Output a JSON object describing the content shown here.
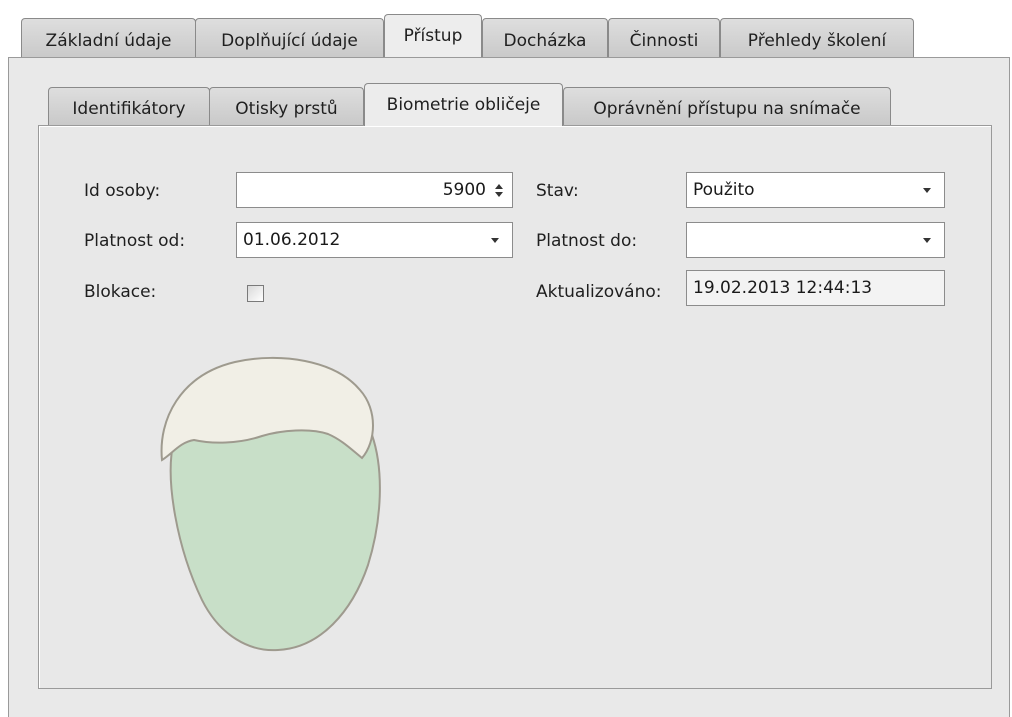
{
  "outer_tabs": [
    {
      "label": "Základní údaje"
    },
    {
      "label": "Doplňující údaje"
    },
    {
      "label": "Přístup"
    },
    {
      "label": "Docházka"
    },
    {
      "label": "Činnosti"
    },
    {
      "label": "Přehledy školení"
    }
  ],
  "outer_active": "Přístup",
  "inner_tabs": [
    {
      "label": "Identifikátory"
    },
    {
      "label": "Otisky prstů"
    },
    {
      "label": "Biometrie obličeje"
    },
    {
      "label": "Oprávnění přístupu na snímače"
    }
  ],
  "inner_active": "Biometrie obličeje",
  "form": {
    "id_osoby_label": "Id osoby:",
    "id_osoby_value": "5900",
    "platnost_od_label": "Platnost od:",
    "platnost_od_value": "01.06.2012",
    "blokace_label": "Blokace:",
    "blokace_checked": false,
    "stav_label": "Stav:",
    "stav_value": "Použito",
    "platnost_do_label": "Platnost do:",
    "platnost_do_value": "",
    "aktualizovano_label": "Aktualizováno:",
    "aktualizovano_value": "19.02.2013 12:44:13"
  },
  "face_placeholder": {
    "icon": "face-silhouette-icon",
    "skin_color": "#c8dfc8",
    "hair_color": "#f1efe6",
    "outline_color": "#9e9a8e"
  }
}
